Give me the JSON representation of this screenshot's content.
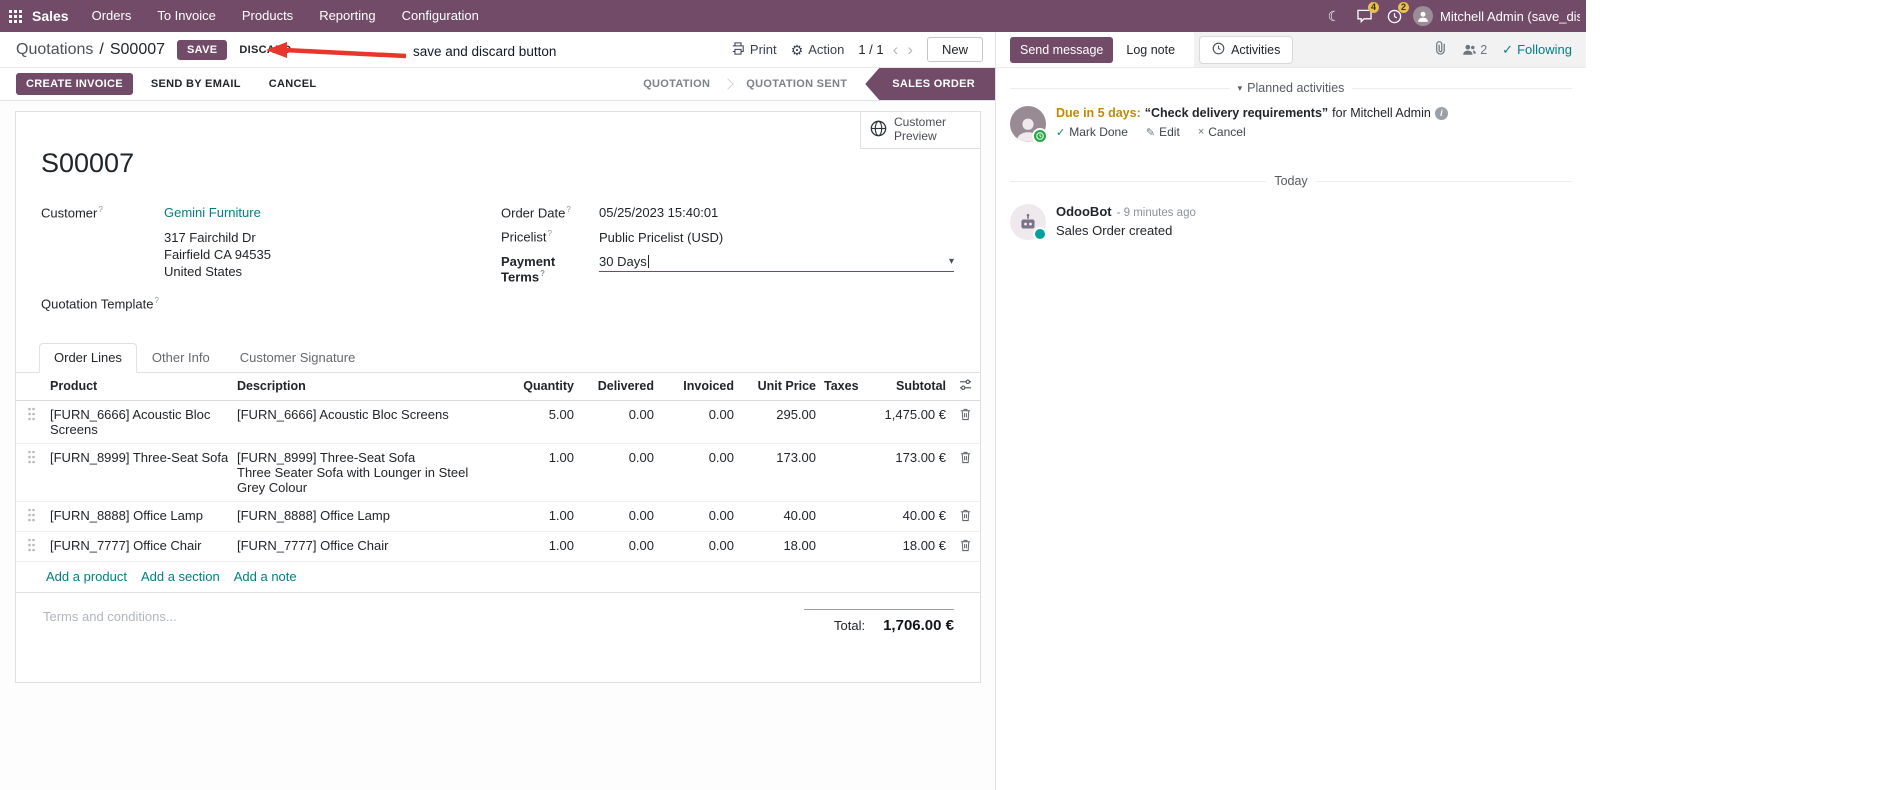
{
  "theme": {
    "primary": "#714B67",
    "link": "#017E84",
    "warning": "#C08A06",
    "annotation_red": "#E8362C",
    "badge_yellow": "#E9C04A"
  },
  "icons": {
    "gear": "⚙",
    "moon": "☾",
    "check": "✓",
    "pencil": "✎",
    "close": "×",
    "caret_down": "▾",
    "chevron_left": "‹",
    "chevron_right": "›",
    "info": "i"
  },
  "navbar": {
    "brand": "Sales",
    "menus": [
      "Orders",
      "To Invoice",
      "Products",
      "Reporting",
      "Configuration"
    ],
    "badges": {
      "messages": "4",
      "activities": "2"
    },
    "user_name": "Mitchell Admin (save_discar"
  },
  "control_panel": {
    "breadcrumb_parent": "Quotations",
    "breadcrumb_separator": "/",
    "breadcrumb_current": "S00007",
    "save_label": "SAVE",
    "discard_label": "DISCARD",
    "print_label": "Print",
    "action_label": "Action",
    "pager": "1 / 1",
    "new_label": "New"
  },
  "annotation": {
    "text": "save and discard button"
  },
  "statusbar": {
    "create_invoice": "CREATE INVOICE",
    "send_by_email": "SEND BY EMAIL",
    "cancel": "CANCEL",
    "stages": [
      {
        "label": "QUOTATION",
        "active": false
      },
      {
        "label": "QUOTATION SENT",
        "active": false
      },
      {
        "label": "SALES ORDER",
        "active": true
      }
    ]
  },
  "sheet": {
    "customer_preview": "Customer Preview",
    "title": "S00007",
    "help_marker": "?",
    "customer": {
      "label": "Customer",
      "name": "Gemini Furniture",
      "address": [
        "317 Fairchild Dr",
        "Fairfield CA 94535",
        "United States"
      ]
    },
    "quotation_template_label": "Quotation Template",
    "order_date": {
      "label": "Order Date",
      "value": "05/25/2023 15:40:01"
    },
    "pricelist": {
      "label": "Pricelist",
      "value": "Public Pricelist (USD)"
    },
    "payment_terms": {
      "label": "Payment Terms",
      "value": "30 Days"
    },
    "tabs": [
      {
        "label": "Order Lines"
      },
      {
        "label": "Other Info"
      },
      {
        "label": "Customer Signature"
      }
    ],
    "order_lines": {
      "headers": [
        "Product",
        "Description",
        "Quantity",
        "Delivered",
        "Invoiced",
        "Unit Price",
        "Taxes",
        "Subtotal"
      ],
      "rows": [
        {
          "product": "[FURN_6666] Acoustic Bloc Screens",
          "description": "[FURN_6666] Acoustic Bloc Screens",
          "description2": "",
          "quantity": "5.00",
          "delivered": "0.00",
          "invoiced": "0.00",
          "unit_price": "295.00",
          "taxes": "",
          "subtotal": "1,475.00 €"
        },
        {
          "product": "[FURN_8999] Three-Seat Sofa",
          "description": "[FURN_8999] Three-Seat Sofa",
          "description2": "Three Seater Sofa with Lounger in Steel Grey Colour",
          "quantity": "1.00",
          "delivered": "0.00",
          "invoiced": "0.00",
          "unit_price": "173.00",
          "taxes": "",
          "subtotal": "173.00 €"
        },
        {
          "product": "[FURN_8888] Office Lamp",
          "description": "[FURN_8888] Office Lamp",
          "description2": "",
          "quantity": "1.00",
          "delivered": "0.00",
          "invoiced": "0.00",
          "unit_price": "40.00",
          "taxes": "",
          "subtotal": "40.00 €"
        },
        {
          "product": "[FURN_7777] Office Chair",
          "description": "[FURN_7777] Office Chair",
          "description2": "",
          "quantity": "1.00",
          "delivered": "0.00",
          "invoiced": "0.00",
          "unit_price": "18.00",
          "taxes": "",
          "subtotal": "18.00 €"
        }
      ],
      "add_product": "Add a product",
      "add_section": "Add a section",
      "add_note": "Add a note"
    },
    "terms_placeholder": "Terms and conditions...",
    "total_label": "Total:",
    "total_value": "1,706.00 €"
  },
  "chatter": {
    "send_message": "Send message",
    "log_note": "Log note",
    "activities_tab": "Activities",
    "followers_count": "2",
    "following": "Following",
    "planned_header": "Planned activities",
    "activity": {
      "due": "Due in 5 days:",
      "summary": "“Check delivery requirements”",
      "assignee": "for Mitchell Admin",
      "mark_done": "Mark Done",
      "edit": "Edit",
      "cancel": "Cancel"
    },
    "date_divider": "Today",
    "messages": [
      {
        "author": "OdooBot",
        "time": "- 9 minutes ago",
        "body": "Sales Order created"
      }
    ]
  }
}
